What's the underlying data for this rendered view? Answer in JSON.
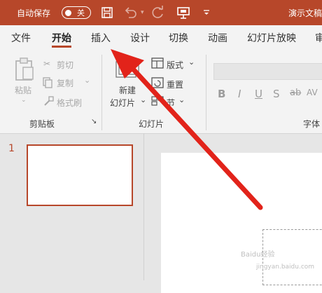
{
  "titlebar": {
    "autosave_label": "自动保存",
    "autosave_state": "关",
    "document_title": "演示文稿"
  },
  "tabs": [
    {
      "label": "文件"
    },
    {
      "label": "开始",
      "active": true
    },
    {
      "label": "插入"
    },
    {
      "label": "设计"
    },
    {
      "label": "切换"
    },
    {
      "label": "动画"
    },
    {
      "label": "幻灯片放映"
    },
    {
      "label": "审"
    }
  ],
  "ribbon": {
    "clipboard": {
      "paste": "粘贴",
      "cut": "剪切",
      "copy": "复制",
      "format_painter": "格式刷",
      "group_label": "剪贴板"
    },
    "slides": {
      "new_slide_line1": "新建",
      "new_slide_line2": "幻灯片",
      "layout": "版式",
      "reset": "重置",
      "section": "节",
      "group_label": "幻灯片"
    },
    "font": {
      "group_label": "字体",
      "buttons": [
        "B",
        "I",
        "U",
        "S",
        "ab",
        "AV"
      ]
    }
  },
  "thumbnails": {
    "slide_number": "1"
  },
  "watermark": {
    "line1": "Baidu经验",
    "line2": "jingyan.baidu.com"
  },
  "colors": {
    "accent": "#b7472a",
    "annotation_arrow": "#e2231a"
  }
}
